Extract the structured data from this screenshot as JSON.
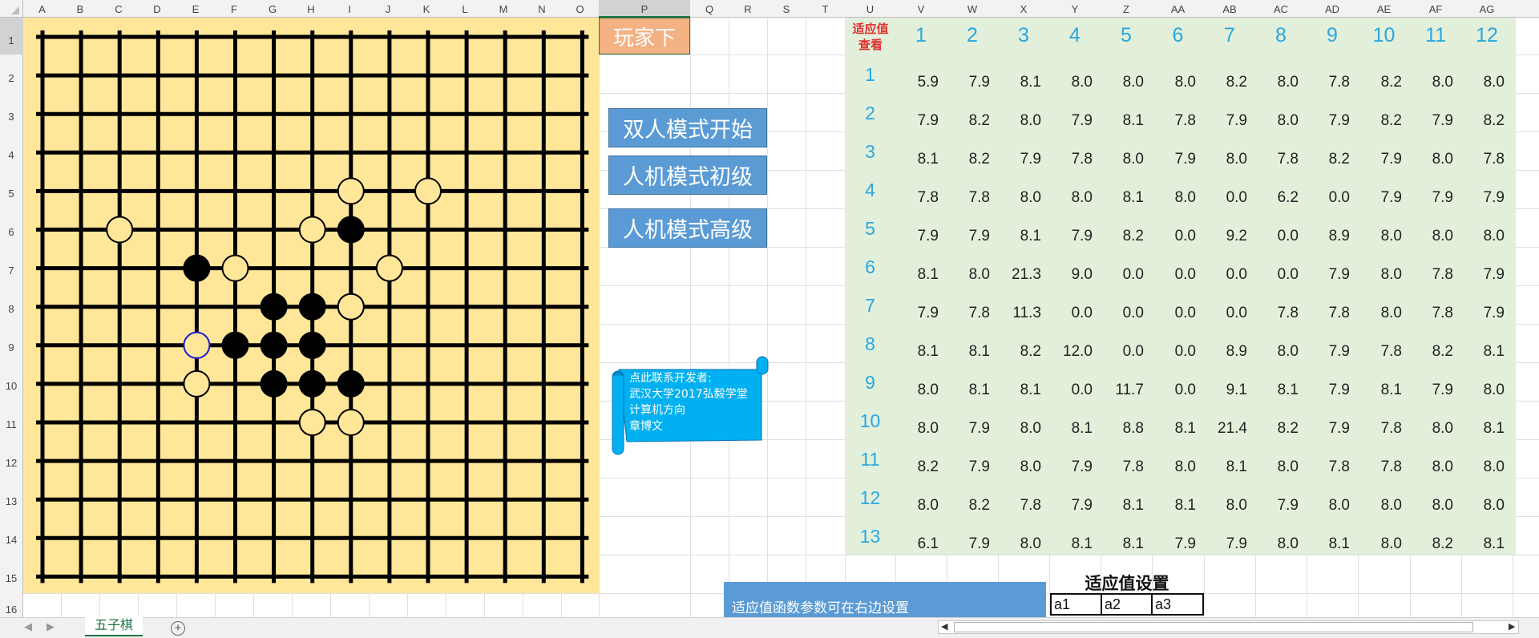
{
  "spreadsheet": {
    "columns": [
      "A",
      "B",
      "C",
      "D",
      "E",
      "F",
      "G",
      "H",
      "I",
      "J",
      "K",
      "L",
      "M",
      "N",
      "O",
      "P",
      "Q",
      "R",
      "S",
      "T",
      "U",
      "V",
      "W",
      "X",
      "Y",
      "Z",
      "AA",
      "AB",
      "AC",
      "AD",
      "AE",
      "AF",
      "AG"
    ],
    "rows": [
      "1",
      "2",
      "3",
      "4",
      "5",
      "6",
      "7",
      "8",
      "9",
      "10",
      "11",
      "12",
      "13",
      "14",
      "15",
      "16"
    ],
    "active_column": "P",
    "active_row": "1",
    "sheet_tab": "五子棋",
    "sheet_tab_color": "#217346"
  },
  "board": {
    "size": 15,
    "background": "#FFE699",
    "black_stones": [
      [
        3,
        8
      ],
      [
        4,
        6
      ],
      [
        6,
        7
      ],
      [
        7,
        6
      ],
      [
        8,
        4
      ],
      [
        8,
        5
      ],
      [
        8,
        6
      ],
      [
        9,
        4
      ],
      [
        9,
        5
      ],
      [
        9,
        6
      ],
      [
        9,
        7
      ],
      [
        10,
        6
      ]
    ],
    "white_stones": [
      [
        4,
        9
      ],
      [
        8,
        9
      ],
      [
        3,
        8
      ],
      [
        4,
        5
      ],
      [
        5,
        7
      ],
      [
        6,
        6
      ],
      [
        7,
        8
      ],
      [
        8,
        7
      ],
      [
        9,
        8
      ],
      [
        10,
        3
      ],
      [
        11,
        5
      ],
      [
        11,
        6
      ],
      [
        11,
        7
      ]
    ],
    "white_placement": [
      [
        1,
        5
      ],
      [
        6,
        6
      ],
      [
        7,
        5
      ],
      [
        8,
        7
      ],
      [
        9,
        7
      ],
      [
        5,
        4
      ],
      [
        7,
        9
      ],
      [
        5,
        10
      ],
      [
        6,
        11
      ],
      [
        7,
        11
      ]
    ],
    "last_move": [
      4,
      9
    ]
  },
  "controls": {
    "player_turn": "玩家下",
    "two_player": "双人模式开始",
    "ai_beginner": "人机模式初级",
    "ai_advanced": "人机模式高级"
  },
  "contact_note": {
    "lines": [
      "点此联系开发者:",
      "武汉大学2017弘毅学堂",
      "计算机方向",
      "章博文"
    ]
  },
  "fitness_table": {
    "title_line1": "适应值",
    "title_line2": "查看",
    "col_headers": [
      "1",
      "2",
      "3",
      "4",
      "5",
      "6",
      "7",
      "8",
      "9",
      "10",
      "11",
      "12"
    ],
    "row_headers": [
      "1",
      "2",
      "3",
      "4",
      "5",
      "6",
      "7",
      "8",
      "9",
      "10",
      "11",
      "12",
      "13"
    ],
    "values": [
      [
        "5.9",
        "7.9",
        "8.1",
        "8.0",
        "8.0",
        "8.0",
        "8.2",
        "8.0",
        "7.8",
        "8.2",
        "8.0",
        "8.0"
      ],
      [
        "7.9",
        "8.2",
        "8.0",
        "7.9",
        "8.1",
        "7.8",
        "7.9",
        "8.0",
        "7.9",
        "8.2",
        "7.9",
        "8.2"
      ],
      [
        "8.1",
        "8.2",
        "7.9",
        "7.8",
        "8.0",
        "7.9",
        "8.0",
        "7.8",
        "8.2",
        "7.9",
        "8.0",
        "7.8"
      ],
      [
        "7.8",
        "7.8",
        "8.0",
        "8.0",
        "8.1",
        "8.0",
        "0.0",
        "6.2",
        "0.0",
        "7.9",
        "7.9",
        "7.9"
      ],
      [
        "7.9",
        "7.9",
        "8.1",
        "7.9",
        "8.2",
        "0.0",
        "9.2",
        "0.0",
        "8.9",
        "8.0",
        "8.0",
        "8.0"
      ],
      [
        "8.1",
        "8.0",
        "21.3",
        "9.0",
        "0.0",
        "0.0",
        "0.0",
        "0.0",
        "7.9",
        "8.0",
        "7.8",
        "7.9"
      ],
      [
        "7.9",
        "7.8",
        "11.3",
        "0.0",
        "0.0",
        "0.0",
        "0.0",
        "7.8",
        "7.8",
        "8.0",
        "7.8",
        "7.9"
      ],
      [
        "8.1",
        "8.1",
        "8.2",
        "12.0",
        "0.0",
        "0.0",
        "8.9",
        "8.0",
        "7.9",
        "7.8",
        "8.2",
        "8.1"
      ],
      [
        "8.0",
        "8.1",
        "8.1",
        "0.0",
        "11.7",
        "0.0",
        "9.1",
        "8.1",
        "7.9",
        "8.1",
        "7.9",
        "8.0"
      ],
      [
        "8.0",
        "7.9",
        "8.0",
        "8.1",
        "8.8",
        "8.1",
        "21.4",
        "8.2",
        "7.9",
        "7.8",
        "8.0",
        "8.1"
      ],
      [
        "8.2",
        "7.9",
        "8.0",
        "7.9",
        "7.8",
        "8.0",
        "8.1",
        "8.0",
        "7.8",
        "7.8",
        "8.0",
        "8.0"
      ],
      [
        "8.0",
        "8.2",
        "7.8",
        "7.9",
        "8.1",
        "8.1",
        "8.0",
        "7.9",
        "8.0",
        "8.0",
        "8.0",
        "8.0"
      ],
      [
        "6.1",
        "7.9",
        "8.0",
        "8.1",
        "8.1",
        "7.9",
        "7.9",
        "8.0",
        "8.1",
        "8.0",
        "8.2",
        "8.1"
      ]
    ]
  },
  "fitness_settings": {
    "title": "适应值设置",
    "hint": "适应值函数参数可在右边设置",
    "params": [
      "a1",
      "a2",
      "a3"
    ]
  }
}
